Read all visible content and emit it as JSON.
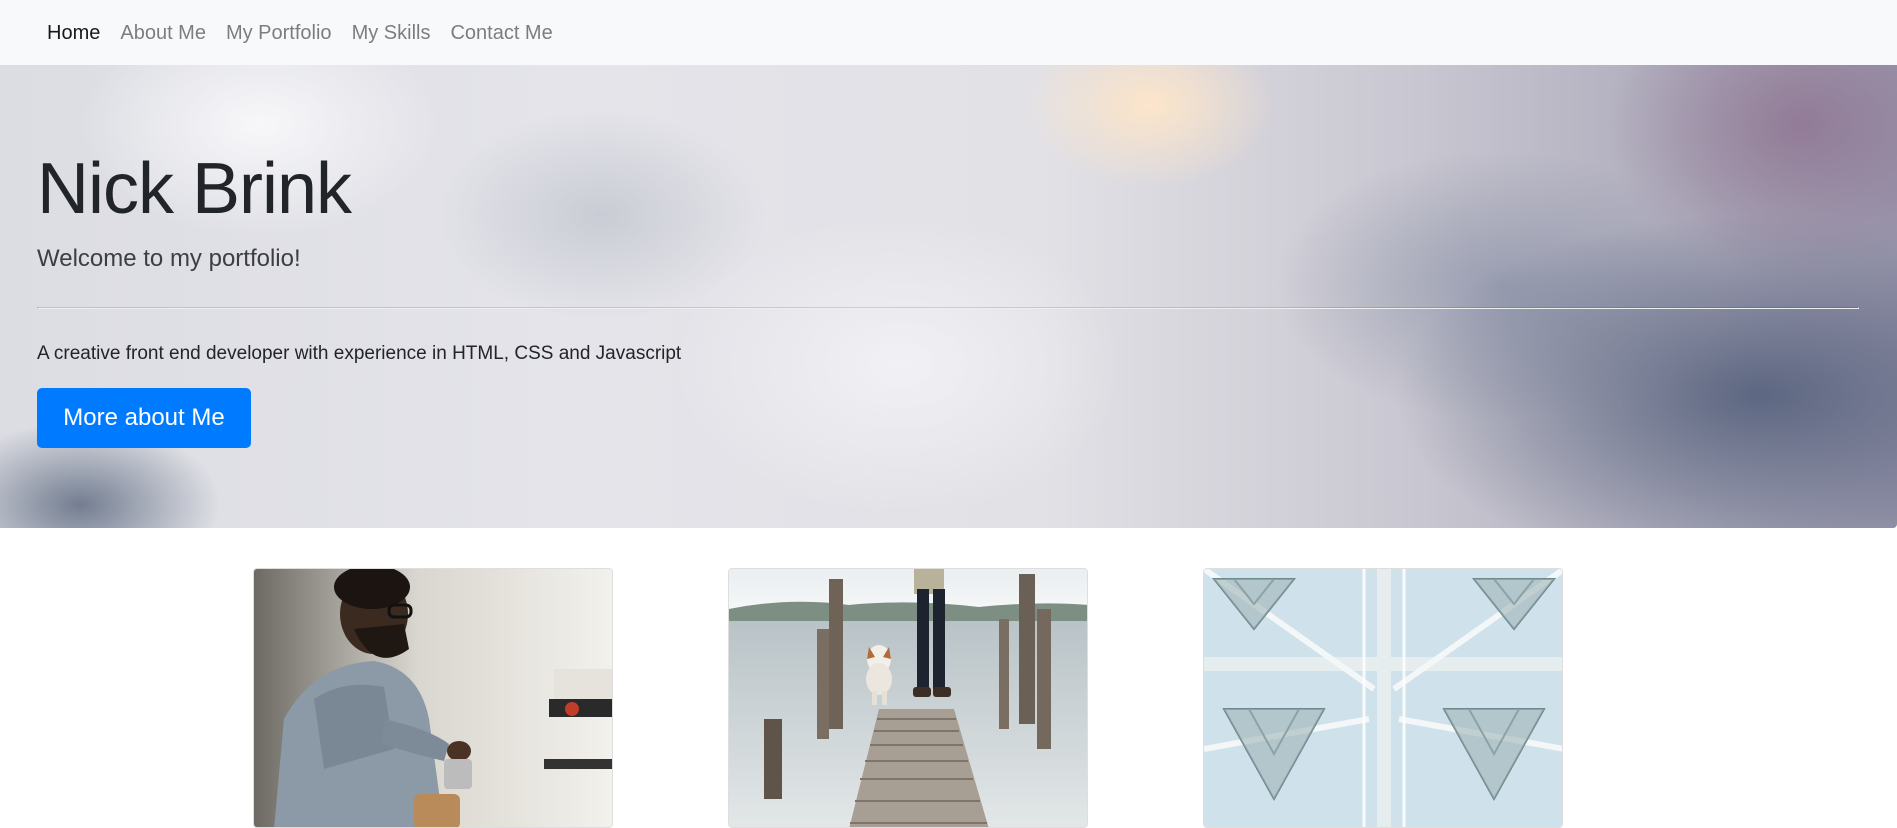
{
  "nav": {
    "items": [
      {
        "label": "Home",
        "active": true
      },
      {
        "label": "About Me",
        "active": false
      },
      {
        "label": "My Portfolio",
        "active": false
      },
      {
        "label": "My Skills",
        "active": false
      },
      {
        "label": "Contact Me",
        "active": false
      }
    ]
  },
  "hero": {
    "title": "Nick Brink",
    "lead": "Welcome to my portfolio!",
    "text": "A creative front end developer with experience in HTML, CSS and Javascript",
    "button_label": "More about Me"
  },
  "colors": {
    "primary": "#007bff",
    "navbar_bg": "#f8f9fa"
  },
  "cards": [
    {
      "image": "barista-photo"
    },
    {
      "image": "dock-with-dog-photo"
    },
    {
      "image": "geometric-structure-photo"
    }
  ]
}
